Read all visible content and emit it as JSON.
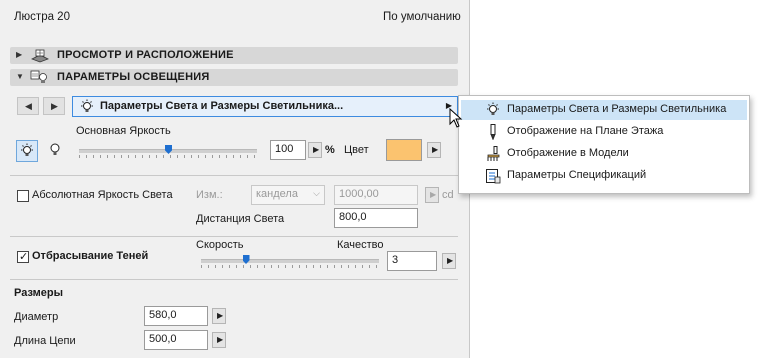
{
  "header": {
    "title": "Люстра 20",
    "default_label": "По умолчанию"
  },
  "sections": {
    "preview": {
      "label": "ПРОСМОТР И РАСПОЛОЖЕНИЕ",
      "icon": "preview-placement-icon"
    },
    "lighting": {
      "label": "ПАРАМЕТРЫ ОСВЕЩЕНИЯ",
      "icon": "lighting-params-icon"
    }
  },
  "page_selector": {
    "label": "Параметры Света и Размеры Светильника...",
    "icon": "bulb-icon"
  },
  "brightness": {
    "label": "Основная Яркость",
    "value": "100",
    "unit": "%",
    "slider_level": 0.5,
    "color_label": "Цвет",
    "color": "#fbc36f"
  },
  "absolute": {
    "label": "Абсолютная Яркость Света",
    "checked": false,
    "units_label": "Изм.:",
    "units_value": "кандела",
    "value": "1000,00",
    "value_unit": "cd",
    "distance_label": "Дистанция Света",
    "distance_value": "800,0"
  },
  "shadows": {
    "label": "Отбрасывание Теней",
    "checked": true,
    "speed_label": "Скорость",
    "quality_label": "Качество",
    "quality_value": "3",
    "slider_level": 0.25
  },
  "sizes": {
    "heading": "Размеры",
    "diameter_label": "Диаметр",
    "diameter_value": "580,0",
    "chain_label": "Длина Цепи",
    "chain_value": "500,0"
  },
  "menu": {
    "items": [
      {
        "label": "Параметры Света и Размеры Светильника",
        "icon": "bulb-icon",
        "highlighted": true
      },
      {
        "label": "Отображение на Плане Этажа",
        "icon": "floor-plan-pen-icon",
        "highlighted": false
      },
      {
        "label": "Отображение в Модели",
        "icon": "model-brush-icon",
        "highlighted": false
      },
      {
        "label": "Параметры Спецификаций",
        "icon": "listing-params-icon",
        "highlighted": false
      }
    ]
  },
  "colors": {
    "accent": "#3d8be0",
    "highlight": "#cde4f7",
    "swatch": "#fbc36f"
  }
}
